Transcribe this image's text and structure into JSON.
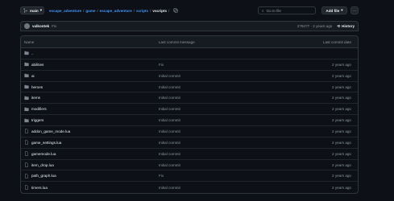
{
  "topbar": {
    "branch": "main",
    "breadcrumb": [
      "escape_adventure",
      "game",
      "escape_adventure",
      "scripts"
    ],
    "current": "vscripts",
    "search_placeholder": "Go to file",
    "add_file_label": "Add file"
  },
  "commit": {
    "author": "valkontek",
    "message": "Fix",
    "hash_time": "2?9477 · 2 years ago",
    "history_label": "History"
  },
  "table": {
    "headers": [
      "Name",
      "Last commit message",
      "Last commit date"
    ],
    "parent_label": "..",
    "rows": [
      {
        "name": "abilities",
        "message": "Fix",
        "date": "2 years ago",
        "type": "folder"
      },
      {
        "name": "ai",
        "message": "Initial commit",
        "date": "2 years ago",
        "type": "folder"
      },
      {
        "name": "heroes",
        "message": "Initial commit",
        "date": "2 years ago",
        "type": "folder"
      },
      {
        "name": "items",
        "message": "Initial commit",
        "date": "2 years ago",
        "type": "folder"
      },
      {
        "name": "modifiers",
        "message": "Initial commit",
        "date": "2 years ago",
        "type": "folder"
      },
      {
        "name": "triggers",
        "message": "Initial commit",
        "date": "2 years ago",
        "type": "folder"
      },
      {
        "name": "addon_game_mode.lua",
        "message": "Initial commit",
        "date": "2 years ago",
        "type": "file"
      },
      {
        "name": "game_settings.lua",
        "message": "Initial commit",
        "date": "2 years ago",
        "type": "file"
      },
      {
        "name": "gamemode.lua",
        "message": "Initial commit",
        "date": "2 years ago",
        "type": "file"
      },
      {
        "name": "item_drop.lua",
        "message": "Initial commit",
        "date": "2 years ago",
        "type": "file"
      },
      {
        "name": "path_graph.lua",
        "message": "Fix",
        "date": "2 years ago",
        "type": "file"
      },
      {
        "name": "timers.lua",
        "message": "Initial commit",
        "date": "2 years ago",
        "type": "file"
      }
    ]
  },
  "colors": {
    "folder": "#7d8590",
    "link": "#4493f8",
    "background": "#0d1117"
  }
}
